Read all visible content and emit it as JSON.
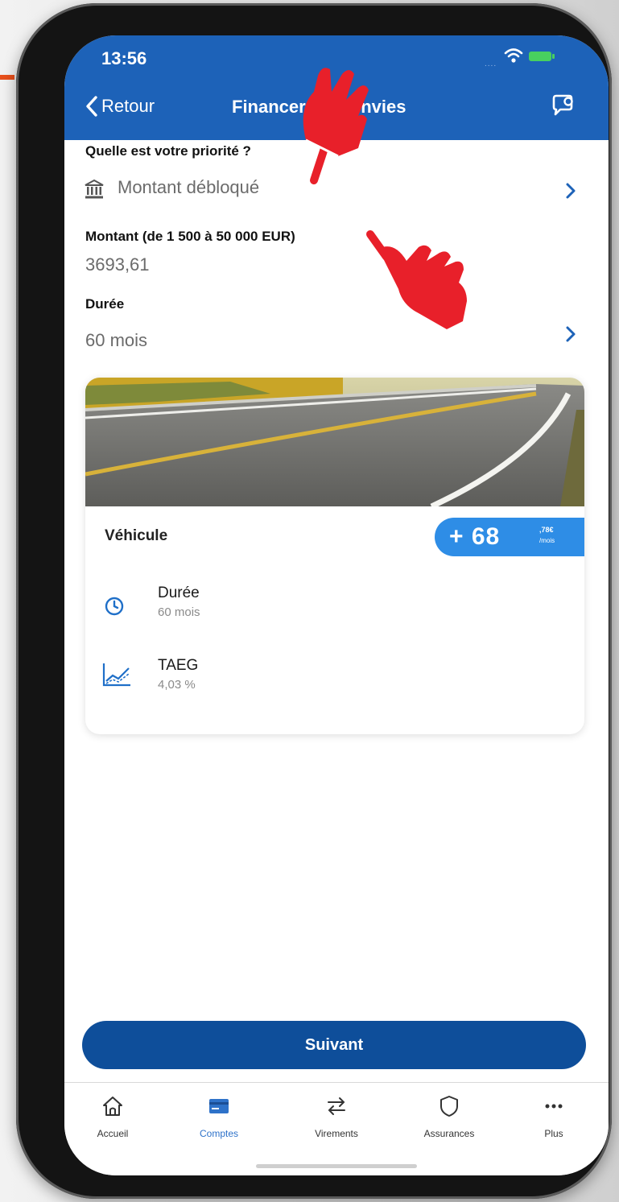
{
  "status_bar": {
    "time": "13:56",
    "signal": "...."
  },
  "nav": {
    "back_label": "Retour",
    "title": "Financer mes envies",
    "chat_icon": "chat-bubble-icon"
  },
  "form": {
    "priority": {
      "label": "Quelle est votre priorité ?",
      "value": "Montant débloqué",
      "icon": "bank-icon"
    },
    "amount": {
      "label": "Montant (de 1 500 à 50 000 EUR)",
      "value": "3693,61"
    },
    "duration": {
      "label": "Durée",
      "value": "60 mois"
    }
  },
  "offer_card": {
    "title": "Véhicule",
    "monthly": {
      "amount": "+ 68",
      "cents": ",78€",
      "unit": "/mois"
    },
    "details": [
      {
        "label": "Durée",
        "value": "60 mois",
        "icon": "clock-icon"
      },
      {
        "label": "TAEG",
        "value": "4,03 %",
        "icon": "chart-icon"
      }
    ]
  },
  "cta": {
    "label": "Suivant"
  },
  "tabbar": {
    "items": [
      {
        "label": "Accueil",
        "icon": "home-icon",
        "active": false
      },
      {
        "label": "Comptes",
        "icon": "card-icon",
        "active": true
      },
      {
        "label": "Virements",
        "icon": "transfer-icon",
        "active": false
      },
      {
        "label": "Assurances",
        "icon": "shield-icon",
        "active": false
      },
      {
        "label": "Plus",
        "icon": "more-icon",
        "active": false
      }
    ]
  },
  "colors": {
    "header_blue": "#1d62b8",
    "primary_button": "#0e4e9a",
    "badge_blue": "#2e8de6",
    "active_tab": "#2e72c9",
    "annotation_red": "#e8202a",
    "annotation_orange": "#e8501c"
  }
}
